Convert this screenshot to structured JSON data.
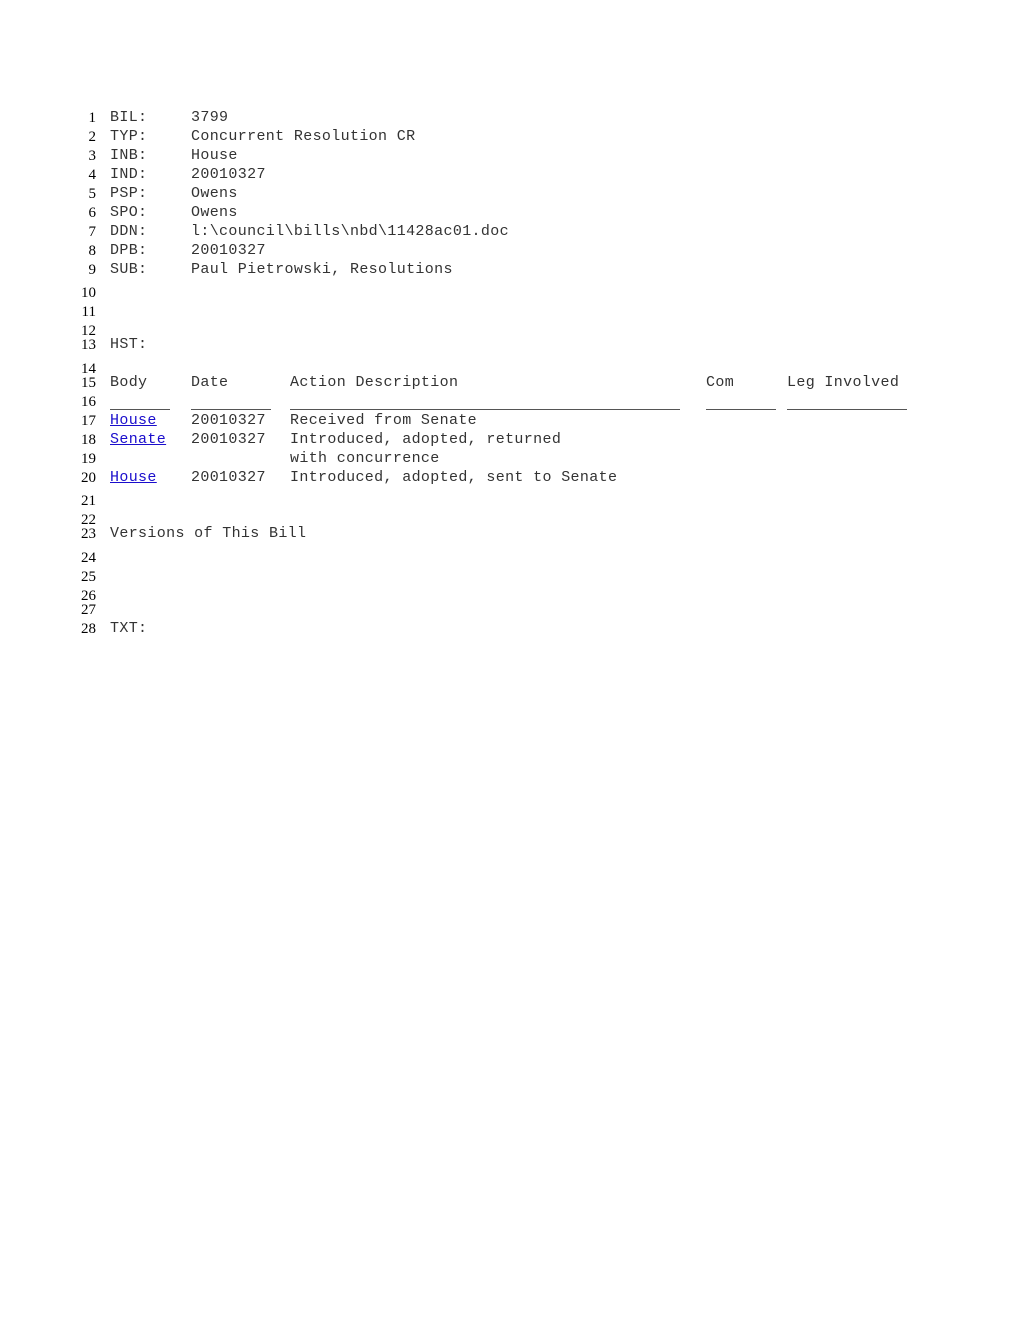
{
  "line_numbers": [
    "1",
    "2",
    "3",
    "4",
    "5",
    "6",
    "7",
    "8",
    "9",
    "10",
    "11",
    "12",
    "13",
    "14",
    "15",
    "16",
    "17",
    "18",
    "19",
    "20",
    "21",
    "22",
    "23",
    "24",
    "25",
    "26",
    "27",
    "28"
  ],
  "fields": [
    {
      "label": "BIL:",
      "value": "3799"
    },
    {
      "label": "TYP:",
      "value": "Concurrent Resolution CR"
    },
    {
      "label": "INB:",
      "value": "House"
    },
    {
      "label": "IND:",
      "value": "20010327"
    },
    {
      "label": "PSP:",
      "value": "Owens"
    },
    {
      "label": "SPO:",
      "value": "Owens"
    },
    {
      "label": "DDN:",
      "value": "l:\\council\\bills\\nbd\\11428ac01.doc"
    },
    {
      "label": "DPB:",
      "value": "20010327"
    },
    {
      "label": "SUB:",
      "value": "Paul Pietrowski, Resolutions"
    }
  ],
  "history": {
    "label": "HST:",
    "columns": [
      "Body",
      "Date",
      "Action Description",
      "Com",
      "Leg Involved"
    ],
    "rows": [
      {
        "body": "House",
        "date": "20010327",
        "action": "Received from Senate",
        "action2": ""
      },
      {
        "body": "Senate",
        "date": "20010327",
        "action": "Introduced, adopted, returned",
        "action2": "with concurrence"
      },
      {
        "body": "House",
        "date": "20010327",
        "action": "Introduced, adopted, sent to Senate",
        "action2": ""
      }
    ]
  },
  "versions_heading": "Versions of This Bill",
  "txt_label": "TXT:"
}
